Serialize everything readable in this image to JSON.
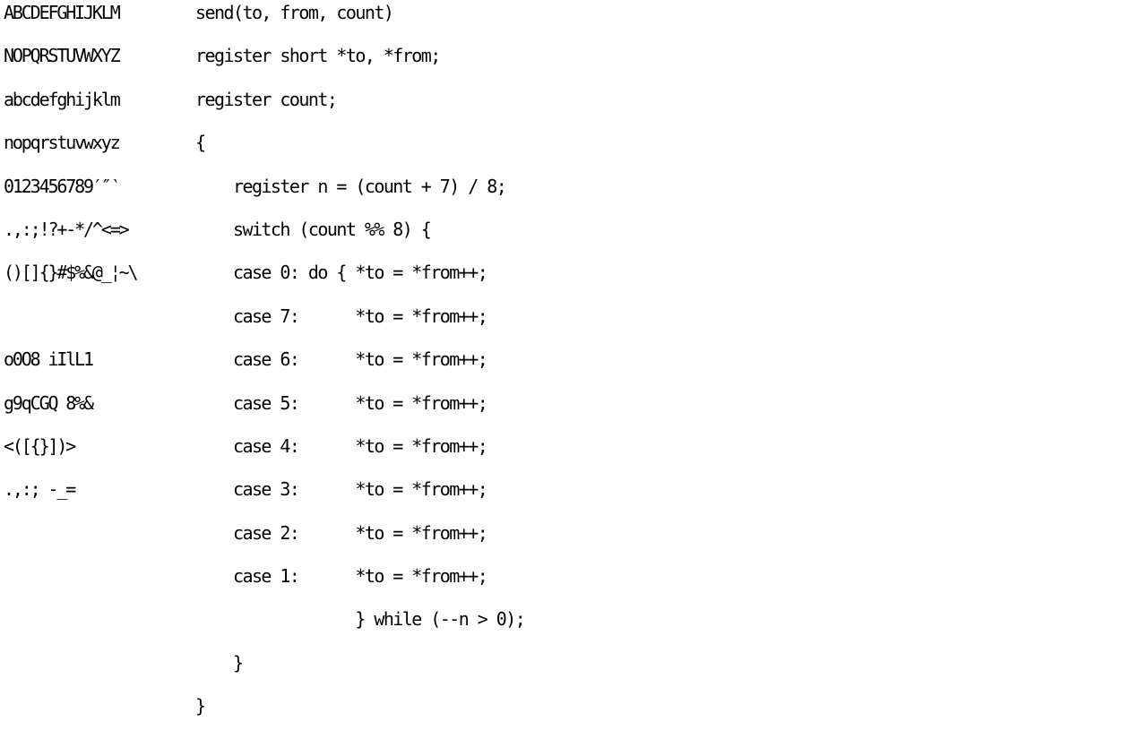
{
  "glyph_specimen": {
    "lines": [
      "ABCDEFGHIJKLM",
      "NOPQRSTUVWXYZ",
      "abcdefghijklm",
      "nopqrstuvwxyz",
      "0123456789′″‵",
      ".,:;!?+-*/^<=>",
      "()[]{}#$%&@_¦~\\",
      "",
      "o0O8 iIlL1",
      "g9qCGQ 8%&",
      "<([{}])>",
      ".,:; -_="
    ]
  },
  "code_sample": {
    "lines": [
      "send(to, from, count)",
      "register short *to, *from;",
      "register count;",
      "{",
      "    register n = (count + 7) / 8;",
      "    switch (count %% 8) {",
      "    case 0: do { *to = *from++;",
      "    case 7:      *to = *from++;",
      "    case 6:      *to = *from++;",
      "    case 5:      *to = *from++;",
      "    case 4:      *to = *from++;",
      "    case 3:      *to = *from++;",
      "    case 2:      *to = *from++;",
      "    case 1:      *to = *from++;",
      "                 } while (--n > 0);",
      "    }",
      "}"
    ]
  }
}
